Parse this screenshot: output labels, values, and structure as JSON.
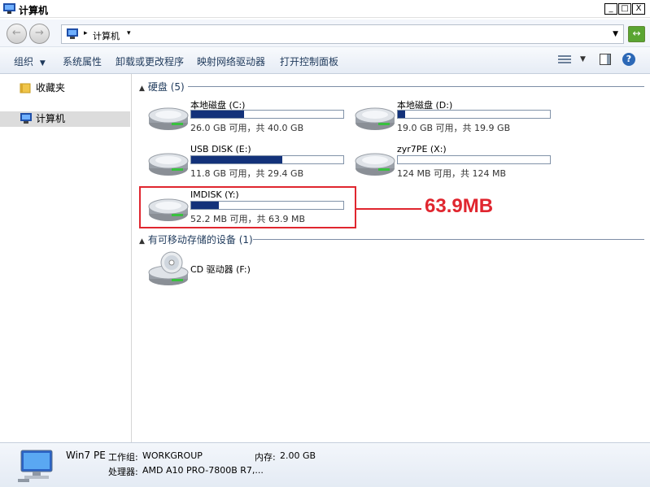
{
  "window": {
    "title": "计算机",
    "min": "_",
    "max": "□",
    "close": "X"
  },
  "nav": {
    "back": "←",
    "forward": "→",
    "address": "计算机",
    "refresh": "↔"
  },
  "toolbar": {
    "organize": "组织",
    "system_properties": "系统属性",
    "uninstall": "卸载或更改程序",
    "map_drive": "映射网络驱动器",
    "control_panel": "打开控制面板",
    "help": "?"
  },
  "sidebar": {
    "favorites": "收藏夹",
    "computer": "计算机"
  },
  "groups": {
    "hard_disks": "硬盘 (5)",
    "removable": "有可移动存储的设备 (1)"
  },
  "drives": [
    {
      "name": "本地磁盘 (C:)",
      "size_text": "26.0 GB 可用，共 40.0 GB",
      "used_fraction": 0.35
    },
    {
      "name": "本地磁盘 (D:)",
      "size_text": "19.0 GB 可用，共 19.9 GB",
      "used_fraction": 0.05
    },
    {
      "name": "USB DISK (E:)",
      "size_text": "11.8 GB 可用，共 29.4 GB",
      "used_fraction": 0.6
    },
    {
      "name": "zyr7PE (X:)",
      "size_text": "124 MB 可用，共 124 MB",
      "used_fraction": 0.0
    },
    {
      "name": "IMDISK (Y:)",
      "size_text": "52.2 MB 可用，共 63.9 MB",
      "used_fraction": 0.18
    }
  ],
  "cd_drive": {
    "name": "CD 驱动器 (F:)"
  },
  "annotation": "63.9MB",
  "details": {
    "computer_name": "Win7 PE",
    "workgroup_label": "工作组:",
    "workgroup_value": "WORKGROUP",
    "memory_label": "内存:",
    "memory_value": "2.00 GB",
    "processor_label": "处理器:",
    "processor_value": "AMD A10 PRO-7800B R7,..."
  },
  "colors": {
    "usage_bar": "#13327a",
    "annotation": "#e0262f"
  }
}
